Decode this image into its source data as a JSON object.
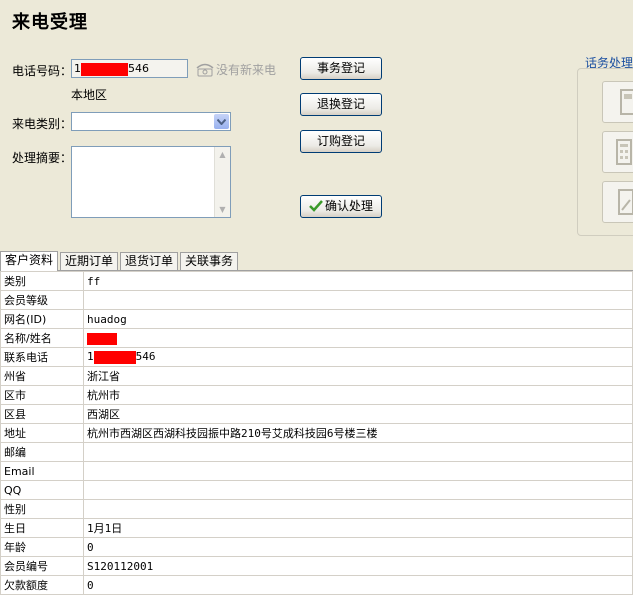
{
  "page": {
    "title": "来电受理"
  },
  "form": {
    "phone_label": "电话号码：",
    "phone_prefix": "1",
    "phone_suffix": "546",
    "no_new_call": "没有新来电",
    "region": "本地区",
    "category_label": "来电类别：",
    "category_value": "",
    "summary_label": "处理摘要：",
    "summary_value": ""
  },
  "actions": {
    "affair": "事务登记",
    "return_exchange": "退换登记",
    "order": "订购登记",
    "confirm": "确认处理"
  },
  "side": {
    "label": "话务处理"
  },
  "tabs": [
    "客户资料",
    "近期订单",
    "退货订单",
    "关联事务"
  ],
  "customer_rows": [
    {
      "key": "类别",
      "value": "ff"
    },
    {
      "key": "会员等级",
      "value": ""
    },
    {
      "key": "网名(ID)",
      "value": "huadog"
    },
    {
      "key": "名称/姓名",
      "value": "",
      "redacted": true
    },
    {
      "key": "联系电话",
      "value_prefix": "1",
      "value_suffix": "546",
      "redacted": true
    },
    {
      "key": "州省",
      "value": "浙江省"
    },
    {
      "key": "区市",
      "value": "杭州市"
    },
    {
      "key": "区县",
      "value": "西湖区"
    },
    {
      "key": "地址",
      "value": "杭州市西湖区西湖科技园振中路210号艾成科技园6号楼三楼"
    },
    {
      "key": "邮编",
      "value": ""
    },
    {
      "key": "Email",
      "value": ""
    },
    {
      "key": "QQ",
      "value": ""
    },
    {
      "key": "性别",
      "value": ""
    },
    {
      "key": "生日",
      "value": "1月1日"
    },
    {
      "key": "年龄",
      "value": "0"
    },
    {
      "key": "会员编号",
      "value": "S120112001"
    },
    {
      "key": "欠款额度",
      "value": "0"
    }
  ]
}
